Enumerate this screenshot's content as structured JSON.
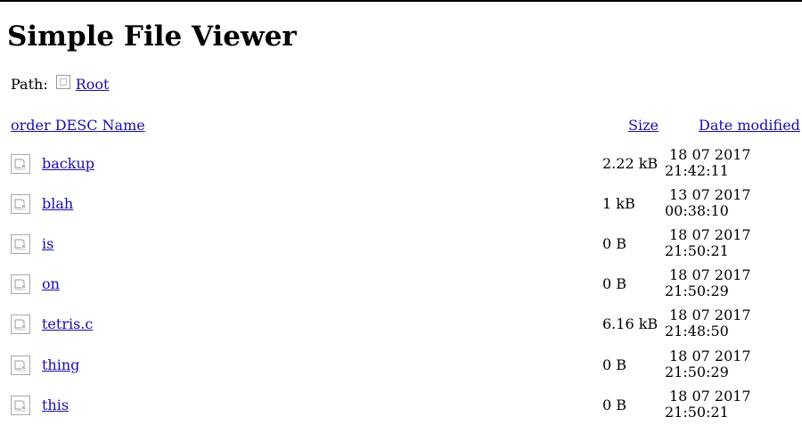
{
  "page": {
    "title": "Simple File Viewer"
  },
  "path": {
    "label": "Path:",
    "root_label": "Root"
  },
  "columns": {
    "name": "order DESC Name",
    "size": "Size",
    "date": "Date modified"
  },
  "files": [
    {
      "name": "backup",
      "size": "2.22 kB",
      "date": "18 07 2017",
      "time": "21:42:11"
    },
    {
      "name": "blah",
      "size": "1 kB",
      "date": "13 07 2017",
      "time": "00:38:10"
    },
    {
      "name": "is",
      "size": "0 B",
      "date": "18 07 2017",
      "time": "21:50:21"
    },
    {
      "name": "on",
      "size": "0 B",
      "date": "18 07 2017",
      "time": "21:50:29"
    },
    {
      "name": "tetris.c",
      "size": "6.16 kB",
      "date": "18 07 2017",
      "time": "21:48:50"
    },
    {
      "name": "thing",
      "size": "0 B",
      "date": "18 07 2017",
      "time": "21:50:29"
    },
    {
      "name": "this",
      "size": "0 B",
      "date": "18 07 2017",
      "time": "21:50:21"
    }
  ],
  "icons": {
    "folder": "broken-image-icon",
    "file": "broken-image-icon"
  },
  "colors": {
    "link": "#1a0dab",
    "text": "#000000",
    "background": "#ffffff"
  }
}
